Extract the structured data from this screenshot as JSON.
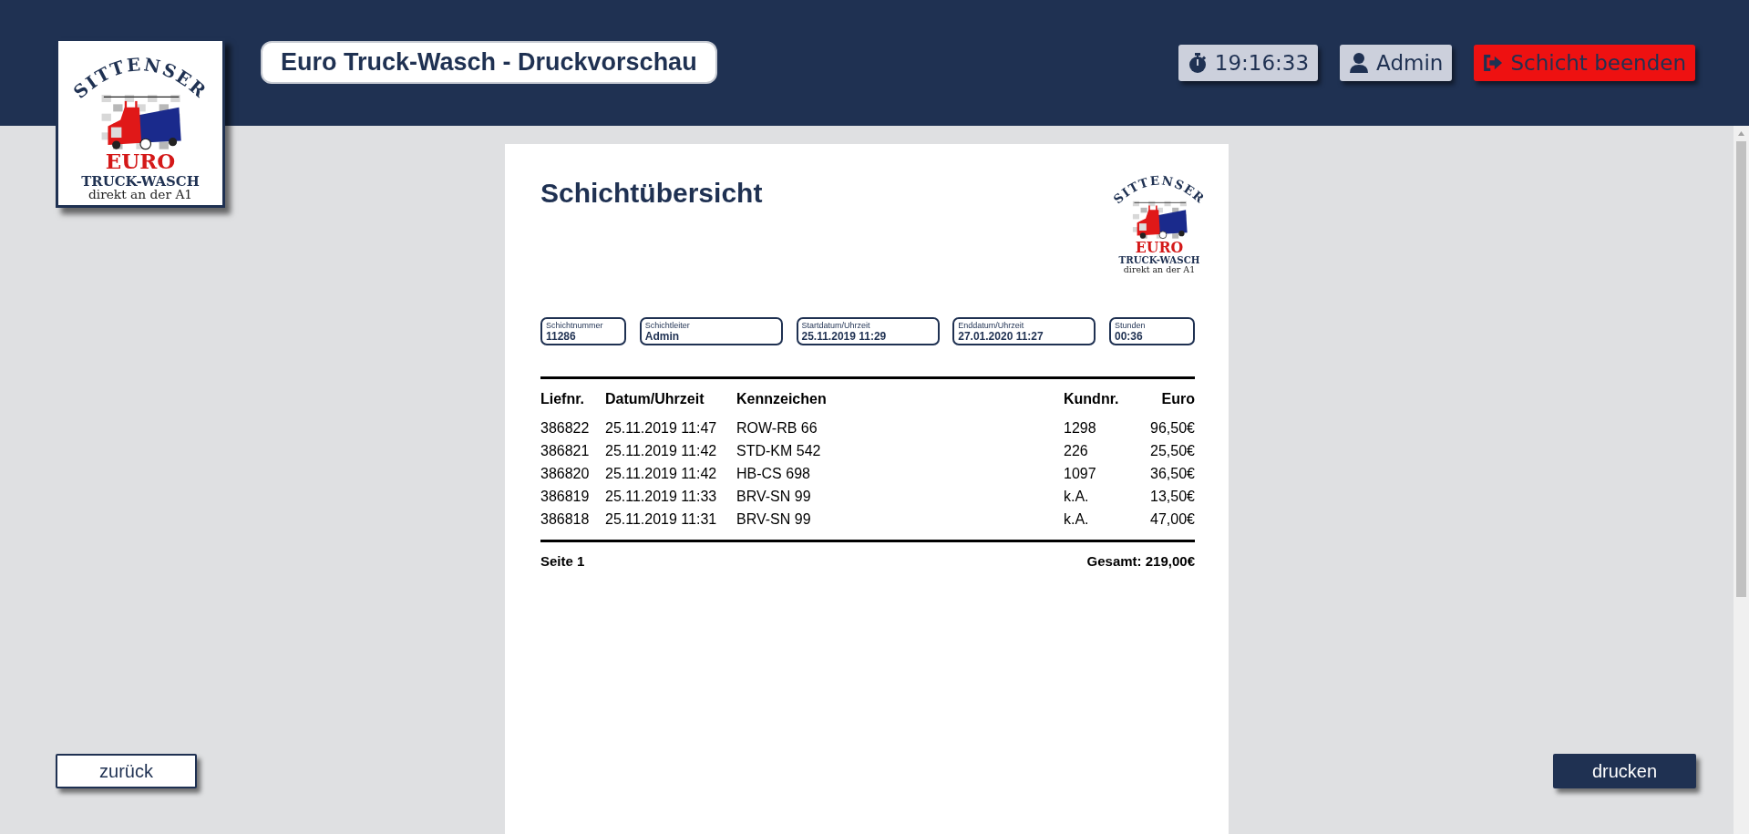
{
  "header": {
    "logo": {
      "arc": "SITTENSER",
      "brand": "EURO",
      "name": "TRUCK-WASCH",
      "tagline": "direkt an der A1"
    },
    "title": "Euro Truck-Wasch - Druckvorschau",
    "clock": "19:16:33",
    "user": "Admin",
    "end_shift_button": "Schicht beenden"
  },
  "document": {
    "title": "Schichtübersicht",
    "logo": {
      "arc": "SITTENSER",
      "brand": "EURO",
      "name": "TRUCK-WASCH",
      "tagline": "direkt an der A1"
    },
    "fields": [
      {
        "label": "Schichtnummer",
        "value": "11286"
      },
      {
        "label": "Schichtleiter",
        "value": "Admin"
      },
      {
        "label": "Startdatum/Uhrzeit",
        "value": "25.11.2019 11:29"
      },
      {
        "label": "Enddatum/Uhrzeit",
        "value": "27.01.2020 11:27"
      },
      {
        "label": "Stunden",
        "value": "00:36"
      }
    ],
    "table": {
      "columns": [
        "Liefnr.",
        "Datum/Uhrzeit",
        "Kennzeichen",
        "Kundnr.",
        "Euro"
      ],
      "rows": [
        [
          "386822",
          "25.11.2019 11:47",
          "ROW-RB 66",
          "1298",
          "96,50€"
        ],
        [
          "386821",
          "25.11.2019 11:42",
          "STD-KM 542",
          "226",
          "25,50€"
        ],
        [
          "386820",
          "25.11.2019 11:42",
          "HB-CS 698",
          "1097",
          "36,50€"
        ],
        [
          "386819",
          "25.11.2019 11:33",
          "BRV-SN 99",
          "k.A.",
          "13,50€"
        ],
        [
          "386818",
          "25.11.2019 11:31",
          "BRV-SN 99",
          "k.A.",
          "47,00€"
        ]
      ]
    },
    "footer": {
      "page": "Seite 1",
      "total": "Gesamt: 219,00€"
    }
  },
  "buttons": {
    "back": "zurück",
    "print": "drucken"
  }
}
